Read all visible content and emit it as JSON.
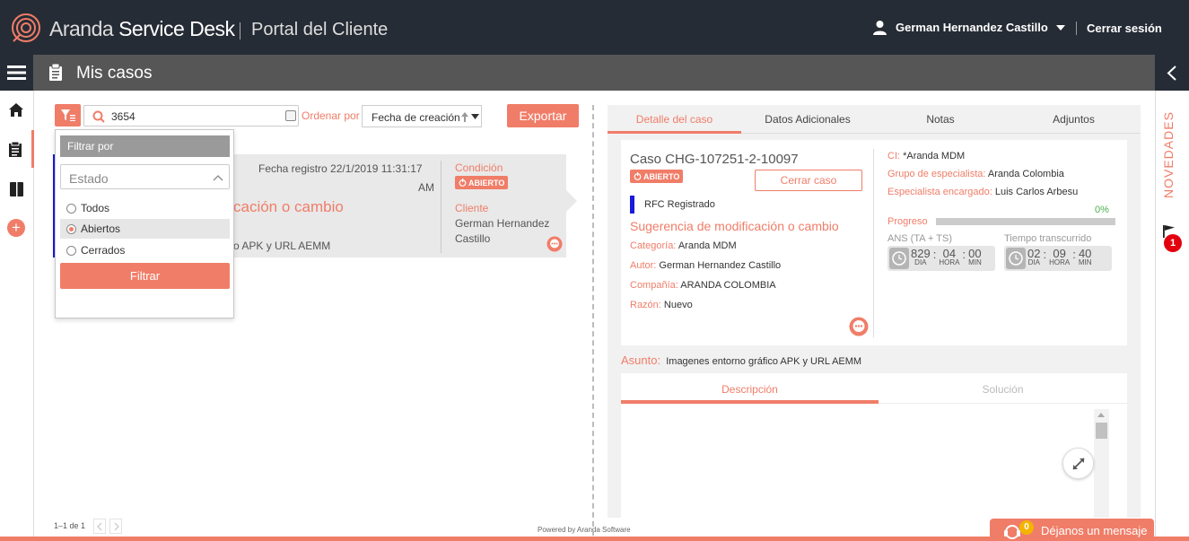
{
  "header": {
    "brand_light": "Aranda",
    "brand_bold": "Service Desk",
    "portal": "Portal del Cliente",
    "user_name": "German Hernandez Castillo",
    "logout": "Cerrar sesión"
  },
  "subheader": {
    "title": "Mis casos"
  },
  "toolbar": {
    "search_value": "3654",
    "order_label": "Ordenar por",
    "order_value": "Fecha de creación",
    "export_label": "Exportar"
  },
  "filter_panel": {
    "title": "Filtrar por",
    "state_placeholder": "Estado",
    "options": [
      "Todos",
      "Abiertos",
      "Cerrados"
    ],
    "selected": "Abiertos",
    "button": "Filtrar"
  },
  "case_card": {
    "date_line1": "Fecha registro 22/1/2019 11:31:17",
    "date_line2": "AM",
    "title_fragment": "cación o cambio",
    "subject_fragment": "o APK y URL AEMM",
    "condition_label": "Condición",
    "condition_badge": "ABIERTO",
    "client_label": "Cliente",
    "client_line1": "German Hernandez",
    "client_line2": "Castillo"
  },
  "pagination": {
    "text": "1–1 de 1"
  },
  "footer": {
    "powered": "Powered by Aranda Software",
    "chat_label": "Déjanos un mensaje",
    "chat_count": "0"
  },
  "detail": {
    "tabs": [
      "Detalle del caso",
      "Datos Adicionales",
      "Notas",
      "Adjuntos"
    ],
    "active_tab": "Detalle del caso",
    "case_title": "Caso CHG-107251-2-10097",
    "status_badge": "ABIERTO",
    "close_button": "Cerrar caso",
    "type": "RFC Registrado",
    "summary": "Sugerencia de modificación o cambio",
    "fields": [
      {
        "label": "Categoría:",
        "value": "Aranda MDM"
      },
      {
        "label": "Autor:",
        "value": "German Hernandez Castillo"
      },
      {
        "label": "Compañía:",
        "value": "ARANDA COLOMBIA"
      },
      {
        "label": "Razón:",
        "value": "Nuevo"
      }
    ],
    "right_fields": [
      {
        "label": "CI:",
        "value": "*Aranda MDM"
      },
      {
        "label": "Grupo de especialista:",
        "value": "Aranda Colombia"
      },
      {
        "label": "Especialista encargado:",
        "value": "Luis Carlos Arbesu"
      }
    ],
    "progress_label": "Progreso",
    "progress_percent_text": "0%",
    "progress": 0,
    "ans_label": "ANS (TA + TS)",
    "ans": {
      "dia": "829",
      "hora": "04",
      "min": "00"
    },
    "elapsed_label": "Tiempo transcurrido",
    "elapsed": {
      "dia": "02",
      "hora": "09",
      "min": "40"
    },
    "unit_dia": "DIA",
    "unit_hora": "HORA",
    "unit_min": "MIN",
    "subject_label": "Asunto:",
    "subject_value": "Imagenes entorno gráfico APK y URL AEMM",
    "desc_tabs": [
      "Descripción",
      "Solución"
    ]
  },
  "side": {
    "novedades": "NOVEDADES",
    "flag_count": "1"
  },
  "colors": {
    "accent": "#f07d68",
    "topbar": "#262c35",
    "subbar": "#565656",
    "progress_ok": "#4cae4c",
    "type_marker": "#1a1adb"
  }
}
